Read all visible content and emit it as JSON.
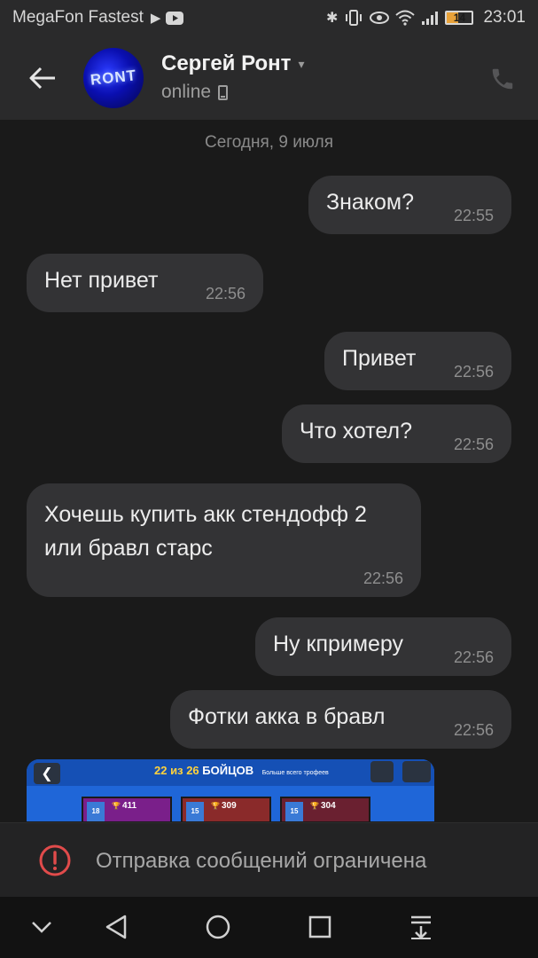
{
  "status_bar": {
    "carrier": "MegaFon Fastest",
    "battery": "14",
    "time": "23:01"
  },
  "header": {
    "contact_name": "Сергей Ронт",
    "status": "online",
    "avatar_text": "RONT"
  },
  "chat": {
    "date_separator": "Сегодня, 9 июля",
    "messages": [
      {
        "side": "out",
        "text": "Знаком?",
        "time": "22:55"
      },
      {
        "side": "in",
        "text": "Нет привет",
        "time": "22:56"
      },
      {
        "side": "out",
        "text": "Привет",
        "time": "22:56"
      },
      {
        "side": "out",
        "text": "Что хотел?",
        "time": "22:56"
      },
      {
        "side": "in",
        "text": "Хочешь купить акк стендофф 2 или бравл старс",
        "time": "22:56"
      },
      {
        "side": "out",
        "text": "Ну кпримеру",
        "time": "22:56"
      },
      {
        "side": "out",
        "text": "Фотки акка в бравл",
        "time": "22:56"
      }
    ],
    "image_message": {
      "title_count_a": "22",
      "title_from": "из",
      "title_count_b": "26",
      "title_word": "БОЙЦОВ",
      "title_sub": "Больше всего трофеев",
      "cards": [
        {
          "level": "18",
          "trophies": "411"
        },
        {
          "level": "15",
          "trophies": "309"
        },
        {
          "level": "15",
          "trophies": "304"
        }
      ]
    }
  },
  "restriction": {
    "text": "Отправка сообщений ограничена"
  },
  "colors": {
    "bubble": "#333335",
    "background": "#1a1a1a",
    "header": "#2a2a2b",
    "warning": "#e14b4b"
  }
}
